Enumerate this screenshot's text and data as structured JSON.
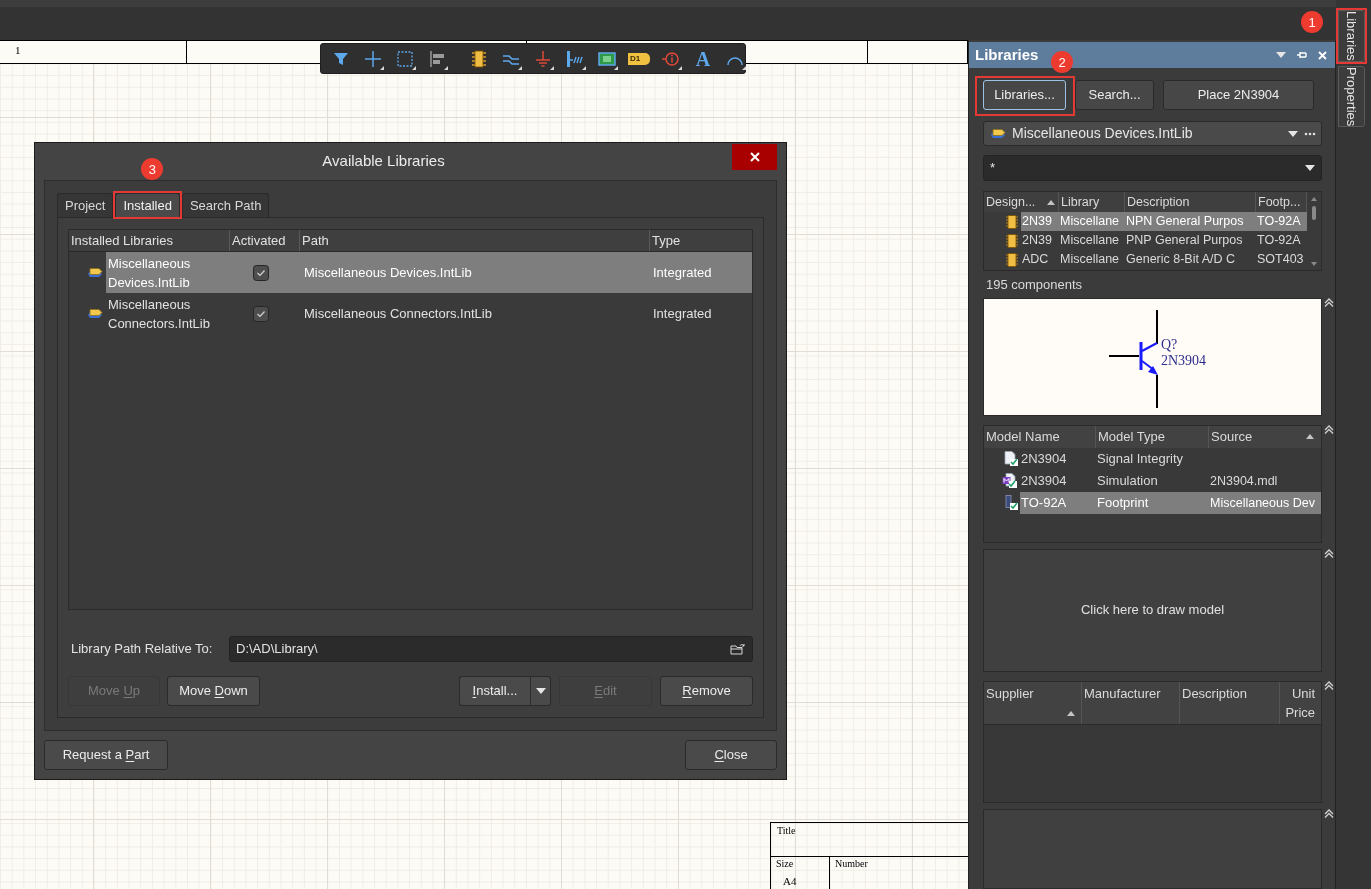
{
  "toolbar": {
    "net_label_tag": "D1",
    "text_tool_glyph": "A"
  },
  "canvas": {
    "zone_labels": [
      "1"
    ],
    "title_block": {
      "title_label": "Title",
      "size_label": "Size",
      "size_value": "A4",
      "number_label": "Number"
    }
  },
  "dialog": {
    "title": "Available Libraries",
    "tabs": [
      {
        "label": "Project",
        "selected": false
      },
      {
        "label": "Installed",
        "selected": true,
        "callout": "3"
      },
      {
        "label": "Search Path",
        "selected": false
      }
    ],
    "table": {
      "columns": [
        "Installed Libraries",
        "Activated",
        "Path",
        "Type"
      ],
      "rows": [
        {
          "name": "Miscellaneous Devices.IntLib",
          "activated": true,
          "path": "Miscellaneous Devices.IntLib",
          "type": "Integrated",
          "selected": true
        },
        {
          "name": "Miscellaneous Connectors.IntLib",
          "activated": true,
          "path": "Miscellaneous Connectors.IntLib",
          "type": "Integrated",
          "selected": false
        }
      ]
    },
    "path_field": {
      "label": "Library Path Relative To:",
      "value": "D:\\AD\\Library\\"
    },
    "order_buttons": [
      {
        "label_start": "Move ",
        "access_key": "U",
        "label_end": "p",
        "disabled": true
      },
      {
        "label_start": "Move ",
        "access_key": "D",
        "label_end": "own",
        "disabled": false
      }
    ],
    "library_buttons": [
      {
        "kind": "split",
        "access_key": "I",
        "label_end": "nstall...",
        "disabled": false
      },
      {
        "kind": "push",
        "access_key": "E",
        "label_end": "dit",
        "disabled": true
      },
      {
        "kind": "push",
        "access_key": "R",
        "label_end": "emove",
        "disabled": false
      }
    ],
    "footer_buttons": [
      {
        "label_start": "Request a ",
        "access_key": "P",
        "label_end": "art"
      },
      {
        "access_key": "C",
        "label_end": "lose"
      }
    ]
  },
  "panel": {
    "title": "Libraries",
    "buttons": [
      {
        "label": "Libraries...",
        "focused": true,
        "callout": "2"
      },
      {
        "label": "Search...",
        "focused": false
      },
      {
        "label": "Place 2N3904",
        "focused": false
      }
    ],
    "library_select": {
      "value": "Miscellaneous Devices.IntLib"
    },
    "filter": {
      "value": "*"
    },
    "components": {
      "columns": [
        {
          "label": "Design...",
          "sorted": true
        },
        {
          "label": "Library",
          "sorted": false
        },
        {
          "label": "Description",
          "sorted": false
        },
        {
          "label": "Footp...",
          "sorted": false
        }
      ],
      "rows": [
        {
          "cells": [
            "2N39",
            "Miscellane",
            "NPN General Purpos",
            "TO-92A"
          ],
          "selected": true
        },
        {
          "cells": [
            "2N39",
            "Miscellane",
            "PNP General Purpos",
            "TO-92A"
          ],
          "selected": false
        },
        {
          "cells": [
            "ADC",
            "Miscellane",
            "Generic 8-Bit A/D C",
            "SOT403"
          ],
          "selected": false
        }
      ]
    },
    "component_count": "195 components",
    "preview": {
      "designator": "Q?",
      "comment": "2N3904"
    },
    "models": {
      "columns": [
        {
          "label": "Model Name",
          "sorted": false
        },
        {
          "label": "Model Type",
          "sorted": false
        },
        {
          "label": "Source",
          "sorted": true
        }
      ],
      "rows": [
        {
          "kind": "signal_integrity",
          "name": "2N3904",
          "type": "Signal Integrity",
          "selected": false
        },
        {
          "kind": "simulation",
          "name": "2N3904",
          "type": "Simulation",
          "source": "2N3904.mdl",
          "selected": false
        },
        {
          "kind": "footprint",
          "name": "TO-92A",
          "type": "Footprint",
          "source": "Miscellaneous Dev",
          "selected": true
        }
      ]
    },
    "model_3d": {
      "hint": "Click here to draw model"
    },
    "suppliers": {
      "columns": [
        {
          "label": "Supplier",
          "sorted": true
        },
        {
          "label": "Manufacturer",
          "sorted": false
        },
        {
          "label": "Description",
          "sorted": false
        },
        {
          "label": "Unit Price",
          "sorted": false
        }
      ]
    }
  },
  "side_tabs": [
    {
      "label": "Libraries",
      "callout": "1"
    },
    {
      "label": "Properties"
    }
  ]
}
